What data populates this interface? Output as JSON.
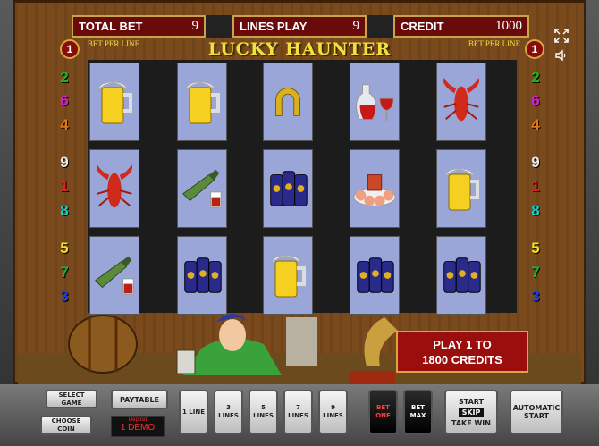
{
  "header": {
    "total_bet_label": "TOTAL BET",
    "total_bet_value": "9",
    "lines_play_label": "LINES PLAY",
    "lines_play_value": "9",
    "credit_label": "CREDIT",
    "credit_value": "1000"
  },
  "title": "LUCKY HAUNTER",
  "bet_per_line": {
    "label_left": "BET PER LINE",
    "label_right": "BET PER LINE",
    "value_left": "1",
    "value_right": "1"
  },
  "left_lines": [
    "2",
    "6",
    "4",
    "9",
    "1",
    "8",
    "5",
    "7",
    "3"
  ],
  "right_lines": [
    "2",
    "6",
    "4",
    "9",
    "1",
    "8",
    "5",
    "7",
    "3"
  ],
  "line_colors": {
    "2": "#1fb31f",
    "6": "#d020d0",
    "4": "#e07a10",
    "9": "#e8e8e8",
    "1": "#e02020",
    "8": "#20c8c8",
    "5": "#f0e020",
    "7": "#20b040",
    "3": "#2040e0"
  },
  "reels": [
    [
      "beer-mug",
      "lobster",
      "bottle-and-glass"
    ],
    [
      "beer-mug",
      "bottle-and-glass",
      "beer-cans"
    ],
    [
      "horseshoe",
      "beer-cans",
      "beer-mug"
    ],
    [
      "wine-decanter",
      "shrimp-plate",
      "beer-cans"
    ],
    [
      "lobster",
      "beer-mug",
      "beer-cans"
    ]
  ],
  "promo": {
    "line1": "PLAY 1 TO",
    "line2": "1800 CREDITS"
  },
  "buttons": {
    "select_game": "SELECT GAME",
    "choose_coin": "CHOOSE COIN",
    "paytable": "PAYTABLE",
    "demo_small": "Deposit",
    "demo": "1 DEMO",
    "line1": "1 LINE",
    "line3": "3 LINES",
    "line5": "5 LINES",
    "line7": "7 LINES",
    "line9": "9 LINES",
    "bet_one": "BET ONE",
    "bet_max": "BET MAX",
    "start": "START",
    "skip": "SKIP",
    "take_win": "TAKE WIN",
    "automatic_start": "AUTOMATIC START"
  },
  "icons": {
    "fullscreen": "fullscreen-icon",
    "sound": "speaker-icon"
  }
}
